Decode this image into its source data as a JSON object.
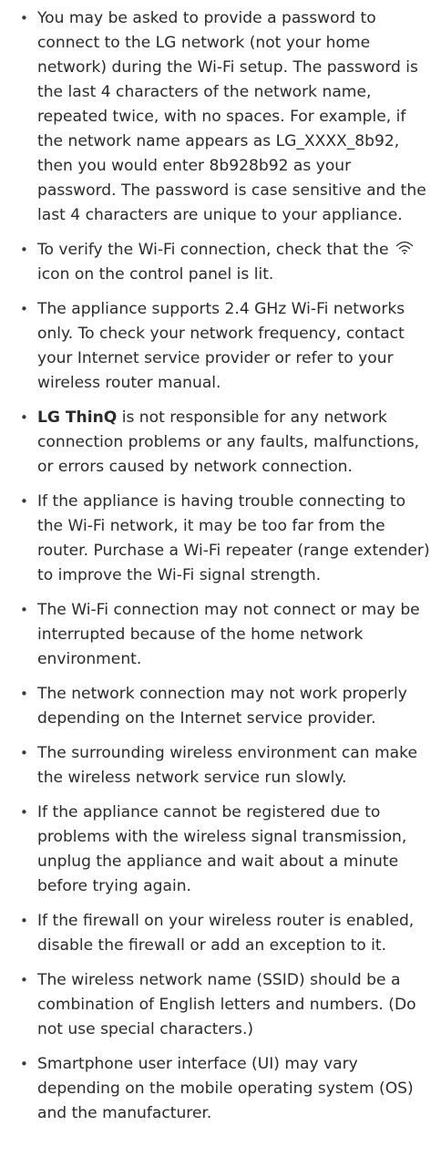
{
  "items": [
    {
      "text": "You may be asked to provide a password to connect to the LG network (not your home network) during the Wi-Fi setup. The password is the last 4 characters of the network name, repeated twice, with no spaces. For example, if the network name appears as LG_XXXX_8b92, then you would enter 8b928b92 as your password. The password is case sensitive and the last 4 characters are unique to your appliance."
    },
    {
      "text_before": "To verify the Wi-Fi connection, check that the",
      "icon": "wifi-icon",
      "text_after": "icon on the control panel is lit."
    },
    {
      "text": "The appliance supports 2.4 GHz Wi-Fi networks only. To check your network frequency, contact your Internet service provider or refer to your wireless router manual."
    },
    {
      "bold": "LG ThinQ",
      "text": "is not responsible for any network connection problems or any faults, malfunctions, or errors caused by network connection."
    },
    {
      "text": "If the appliance is having trouble connecting to the Wi-Fi network, it may be too far from the router. Purchase a Wi-Fi repeater (range extender) to improve the Wi-Fi signal strength."
    },
    {
      "text": "The Wi-Fi connection may not connect or may be interrupted because of the home network environment."
    },
    {
      "text": "The network connection may not work properly depending on the Internet service provider."
    },
    {
      "text": "The surrounding wireless environment can make the wireless network service run slowly."
    },
    {
      "text": "If the appliance cannot be registered due to problems with the wireless signal transmission, unplug the appliance and wait about a minute before trying again."
    },
    {
      "text": "If the firewall on your wireless router is enabled, disable the firewall or add an exception to it."
    },
    {
      "text": "The wireless network name (SSID) should be a combination of English letters and numbers. (Do not use special characters.)"
    },
    {
      "text": "Smartphone user interface (UI) may vary depending on the mobile operating system (OS) and the manufacturer."
    }
  ]
}
